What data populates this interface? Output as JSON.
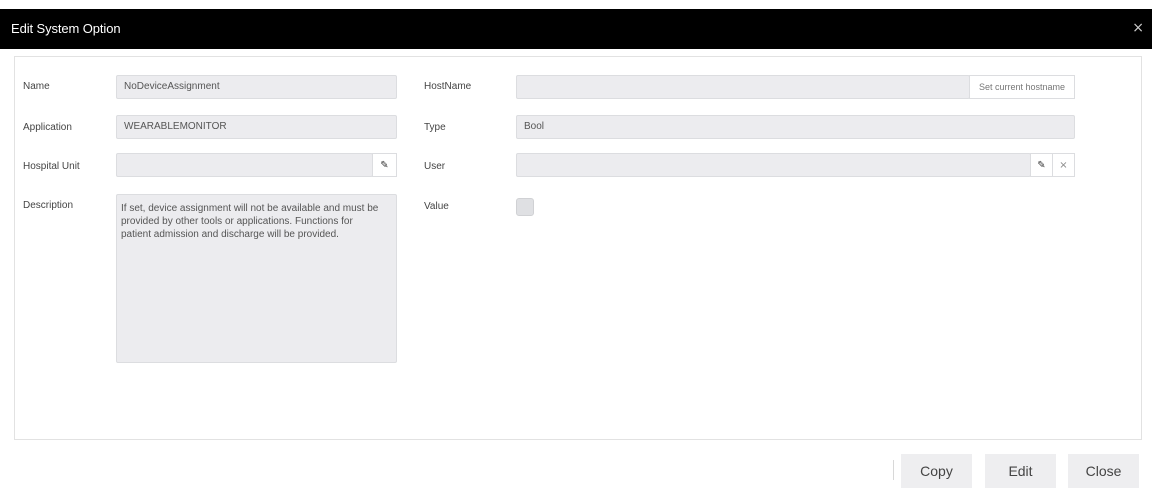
{
  "dialog": {
    "title": "Edit System Option",
    "close_glyph": "×"
  },
  "form": {
    "name": {
      "label": "Name",
      "value": "NoDeviceAssignment"
    },
    "application": {
      "label": "Application",
      "value": "WEARABLEMONITOR"
    },
    "hospital_unit": {
      "label": "Hospital Unit",
      "value": "",
      "edit_icon": "pencil-icon"
    },
    "description": {
      "label": "Description",
      "value": "If set, device assignment will not be available and must be provided by other tools or applications. Functions for patient admission and discharge will be provided."
    },
    "hostname": {
      "label": "HostName",
      "value": "",
      "set_current_label": "Set current hostname"
    },
    "type": {
      "label": "Type",
      "value": "Bool"
    },
    "user": {
      "label": "User",
      "value": "",
      "edit_icon": "pencil-icon",
      "clear_icon": "close-icon"
    },
    "value": {
      "label": "Value",
      "checked": false
    }
  },
  "footer": {
    "copy_label": "Copy",
    "edit_label": "Edit",
    "close_label": "Close"
  },
  "icons": {
    "pencil_glyph": "✎",
    "clear_glyph": "×"
  },
  "colors": {
    "titlebar_bg": "#000000",
    "field_bg": "#ececef",
    "button_bg": "#eeeef0"
  }
}
